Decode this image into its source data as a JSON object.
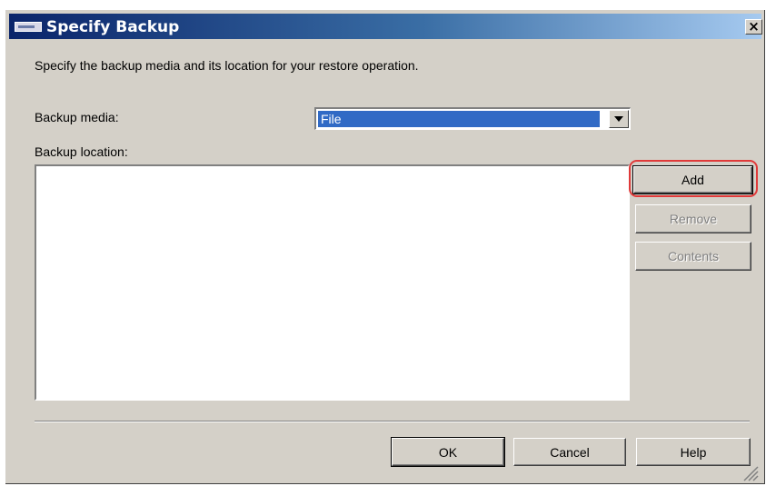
{
  "dialog": {
    "title": "Specify Backup",
    "close_label": "×",
    "instruction": "Specify the backup media and its location for your restore operation.",
    "backup_media_label": "Backup media:",
    "backup_media_value": "File",
    "backup_location_label": "Backup location:",
    "backup_location_items": []
  },
  "side_buttons": {
    "add": "Add",
    "remove": "Remove",
    "contents": "Contents"
  },
  "footer_buttons": {
    "ok": "OK",
    "cancel": "Cancel",
    "help": "Help"
  },
  "colors": {
    "dialog_bg": "#d4d0c8",
    "title_start": "#0a246a",
    "selection": "#316ac5",
    "highlight": "#e03a3a"
  },
  "icons": {
    "title": "window-icon",
    "close": "close-icon",
    "dropdown": "chevron-down-icon",
    "grip": "resize-grip-icon"
  }
}
